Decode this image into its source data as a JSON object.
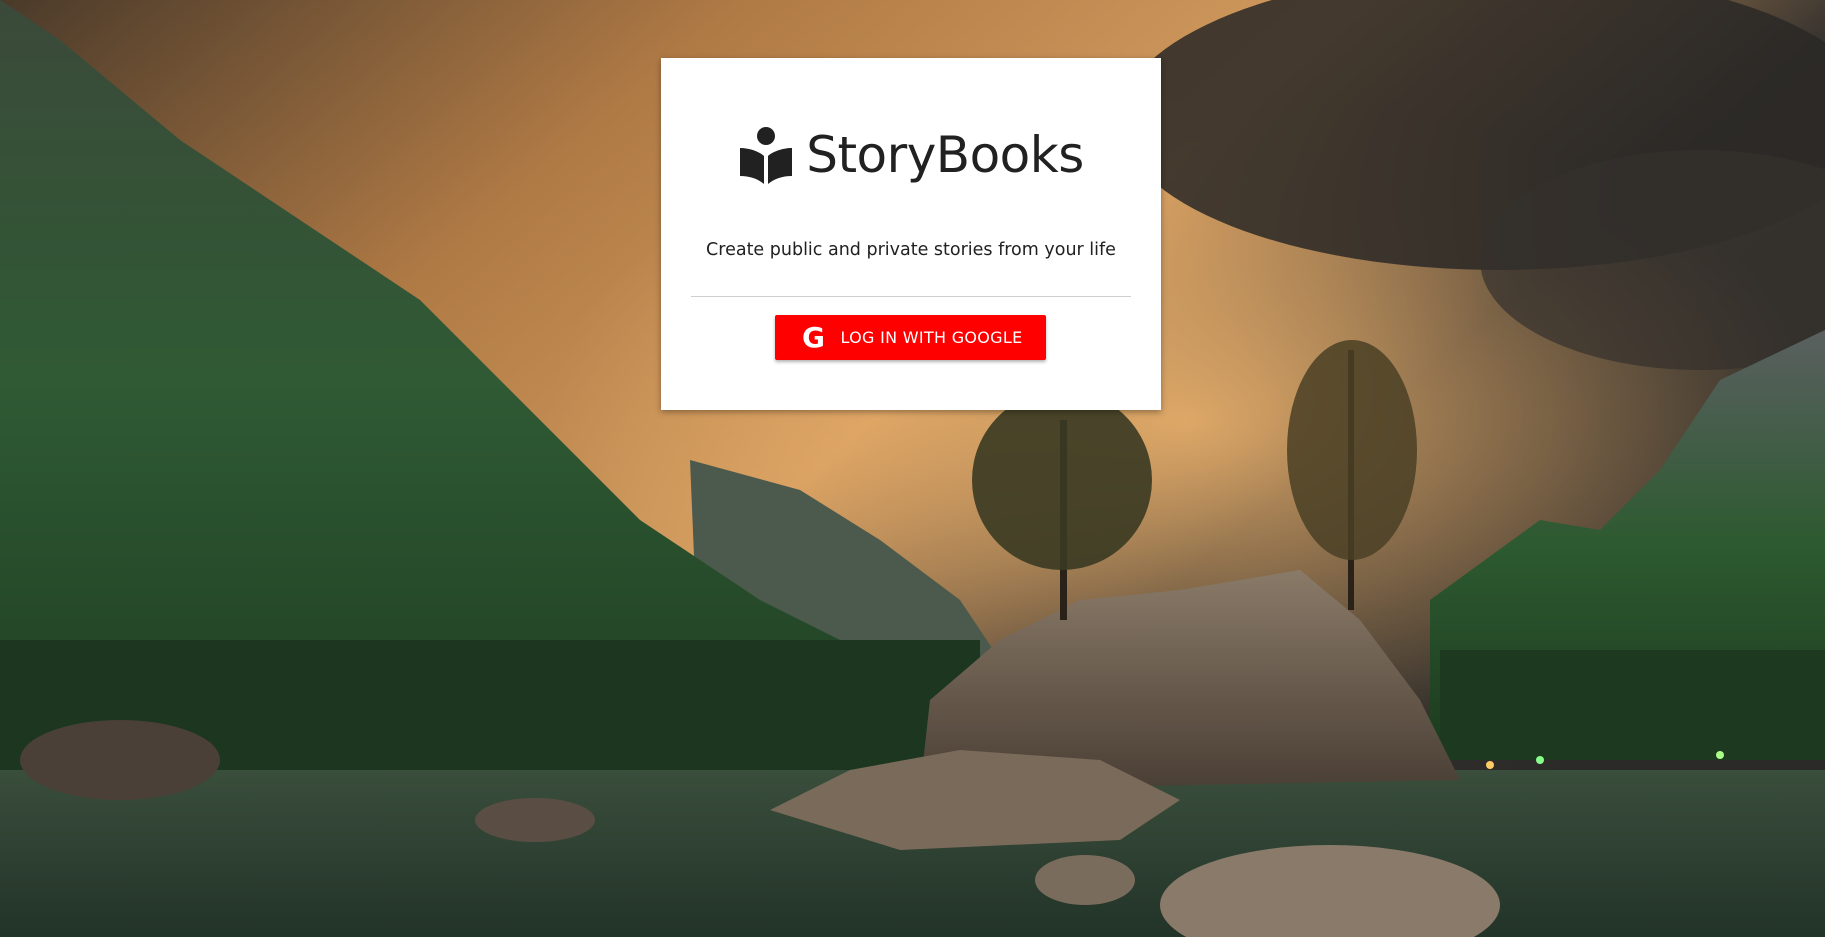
{
  "brand": {
    "title": "StoryBooks",
    "icon": "book-reader-icon"
  },
  "tagline": "Create public and private stories from your life",
  "login": {
    "label": "LOG IN WITH GOOGLE",
    "icon": "google-icon",
    "icon_glyph": "G"
  },
  "colors": {
    "button": "#ff0000",
    "card": "#ffffff",
    "text": "#212121"
  },
  "background": "mountain-lake-landscape-image"
}
